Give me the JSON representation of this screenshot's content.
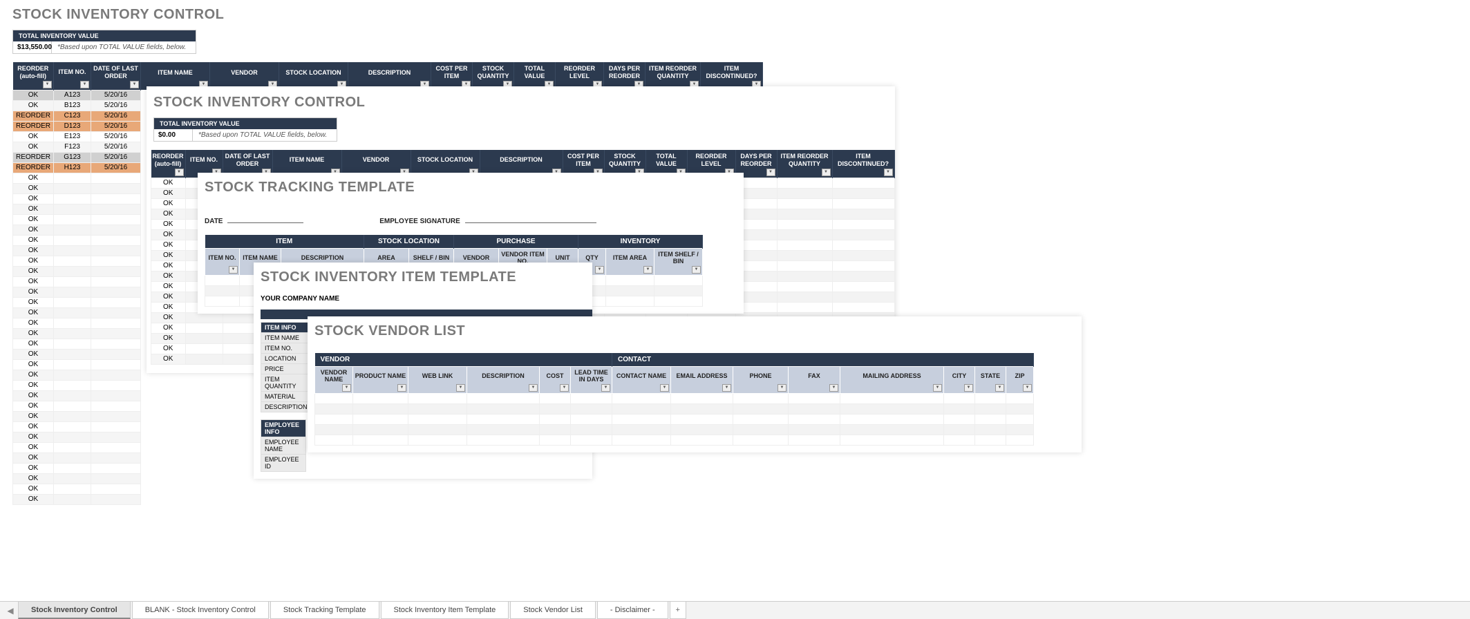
{
  "main": {
    "title": "STOCK INVENTORY CONTROL",
    "summary_header": "TOTAL INVENTORY VALUE",
    "summary_value": "$13,550.00",
    "summary_note": "*Based upon TOTAL VALUE fields, below.",
    "headers": [
      "REORDER (auto-fill)",
      "ITEM NO.",
      "DATE OF LAST ORDER",
      "ITEM NAME",
      "VENDOR",
      "STOCK LOCATION",
      "DESCRIPTION",
      "COST PER ITEM",
      "STOCK QUANTITY",
      "TOTAL VALUE",
      "REORDER LEVEL",
      "DAYS PER REORDER",
      "ITEM REORDER QUANTITY",
      "ITEM DISCONTINUED?"
    ],
    "rows": [
      {
        "status": "OK",
        "item": "A123",
        "date": "5/20/16",
        "disc": true
      },
      {
        "status": "OK",
        "item": "B123",
        "date": "5/20/16"
      },
      {
        "status": "REORDER",
        "item": "C123",
        "date": "5/20/16",
        "reorder": true
      },
      {
        "status": "REORDER",
        "item": "D123",
        "date": "5/20/16",
        "reorder": true
      },
      {
        "status": "OK",
        "item": "E123",
        "date": "5/20/16"
      },
      {
        "status": "OK",
        "item": "F123",
        "date": "5/20/16"
      },
      {
        "status": "REORDER",
        "item": "G123",
        "date": "5/20/16",
        "disc": true
      },
      {
        "status": "REORDER",
        "item": "H123",
        "date": "5/20/16",
        "reorder": true
      }
    ],
    "ok_label": "OK",
    "extra_ok_rows": 32
  },
  "blank": {
    "title": "STOCK INVENTORY CONTROL",
    "summary_header": "TOTAL INVENTORY VALUE",
    "summary_value": "$0.00",
    "summary_note": "*Based upon TOTAL VALUE fields, below.",
    "headers": [
      "REORDER (auto-fill)",
      "ITEM NO.",
      "DATE OF LAST ORDER",
      "ITEM NAME",
      "VENDOR",
      "STOCK LOCATION",
      "DESCRIPTION",
      "COST PER ITEM",
      "STOCK QUANTITY",
      "TOTAL VALUE",
      "REORDER LEVEL",
      "DAYS PER REORDER",
      "ITEM REORDER QUANTITY",
      "ITEM DISCONTINUED?"
    ],
    "ok_label": "OK",
    "extra_ok_rows": 18
  },
  "tracking": {
    "title": "STOCK TRACKING TEMPLATE",
    "date_label": "DATE",
    "sig_label": "EMPLOYEE SIGNATURE",
    "bands": [
      "ITEM",
      "STOCK LOCATION",
      "PURCHASE",
      "INVENTORY"
    ],
    "headers": [
      "ITEM NO.",
      "ITEM NAME",
      "DESCRIPTION",
      "AREA",
      "SHELF / BIN",
      "VENDOR",
      "VENDOR ITEM NO.",
      "UNIT",
      "QTY",
      "ITEM AREA",
      "ITEM SHELF / BIN"
    ],
    "band_spans": [
      3,
      2,
      3,
      3
    ]
  },
  "item_tpl": {
    "title": "STOCK INVENTORY ITEM TEMPLATE",
    "company_label": "YOUR COMPANY NAME",
    "item_info_header": "ITEM INFO",
    "item_fields": [
      "ITEM NAME",
      "ITEM NO.",
      "LOCATION",
      "PRICE",
      "ITEM QUANTITY",
      "MATERIAL",
      "DESCRIPTION"
    ],
    "emp_info_header": "EMPLOYEE INFO",
    "emp_fields": [
      "EMPLOYEE NAME",
      "EMPLOYEE ID"
    ]
  },
  "vendor": {
    "title": "STOCK VENDOR LIST",
    "bands": [
      "VENDOR",
      "CONTACT"
    ],
    "headers": [
      "VENDOR NAME",
      "PRODUCT NAME",
      "WEB LINK",
      "DESCRIPTION",
      "COST",
      "LEAD TIME IN DAYS",
      "CONTACT NAME",
      "EMAIL ADDRESS",
      "PHONE",
      "FAX",
      "MAILING ADDRESS",
      "CITY",
      "STATE",
      "ZIP"
    ],
    "band_spans": [
      6,
      8
    ]
  },
  "tabs": [
    "Stock Inventory Control",
    "BLANK - Stock Inventory Control",
    "Stock Tracking Template",
    "Stock Inventory Item Template",
    "Stock Vendor List",
    "- Disclaimer -"
  ]
}
